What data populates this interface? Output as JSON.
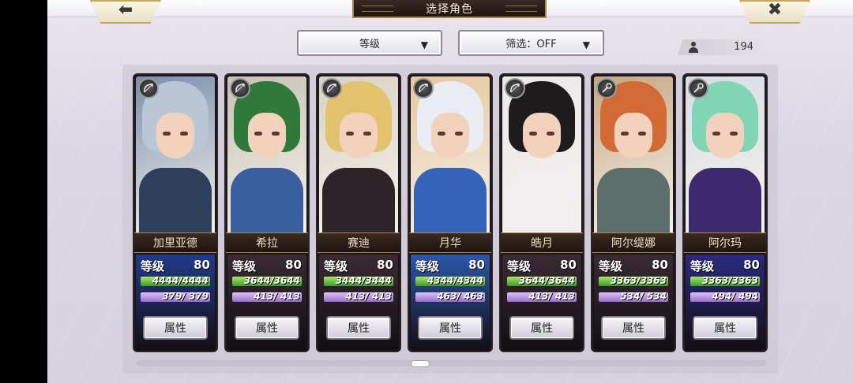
{
  "title": "选择角色",
  "nav": {
    "back_glyph": "⬅",
    "close_glyph": "✖"
  },
  "sort": {
    "label": "等级",
    "caret": "▼"
  },
  "filter": {
    "label": "筛选：OFF",
    "caret": "▼"
  },
  "count": {
    "value": "194"
  },
  "level_label": "等级",
  "attr_button_label": "属性",
  "characters": [
    {
      "name": "加里亚德",
      "level": "80",
      "hp": "4444/4444",
      "sp": "379/ 379",
      "class_icon": "bow-icon",
      "colors": {
        "bg": "#7a8fae",
        "hair": "#b9c6d6",
        "body": "#2e3f5c",
        "stats_bg": "#223a8a"
      }
    },
    {
      "name": "希拉",
      "level": "80",
      "hp": "3644/3644",
      "sp": "413/ 413",
      "class_icon": "bow-icon",
      "colors": {
        "bg": "#c8c2b6",
        "hair": "#2f7a3a",
        "body": "#3a5f9e",
        "stats_bg": "#3a2a33"
      }
    },
    {
      "name": "赛迪",
      "level": "80",
      "hp": "3444/3444",
      "sp": "413/ 413",
      "class_icon": "bow-icon",
      "colors": {
        "bg": "#d8d2c6",
        "hair": "#e3c26e",
        "body": "#2b2428",
        "stats_bg": "#3a2a33"
      }
    },
    {
      "name": "月华",
      "level": "80",
      "hp": "4344/4344",
      "sp": "463/ 463",
      "class_icon": "bow-icon",
      "colors": {
        "bg": "#e6c7a0",
        "hair": "#e9ecf2",
        "body": "#3563b8",
        "stats_bg": "#2b57a8"
      }
    },
    {
      "name": "皓月",
      "level": "80",
      "hp": "3644/3644",
      "sp": "413/ 413",
      "class_icon": "bow-icon",
      "colors": {
        "bg": "#ede8ec",
        "hair": "#1f1a1c",
        "body": "#f2eef0",
        "stats_bg": "#3a2a33"
      }
    },
    {
      "name": "阿尔缇娜",
      "level": "80",
      "hp": "3363/3363",
      "sp": "534/ 534",
      "class_icon": "staff-icon",
      "colors": {
        "bg": "#c7a785",
        "hair": "#d26a36",
        "body": "#5c6f6a",
        "stats_bg": "#3a2a33"
      }
    },
    {
      "name": "阿尔玛",
      "level": "80",
      "hp": "3363/3363",
      "sp": "494/ 494",
      "class_icon": "staff-icon",
      "colors": {
        "bg": "#d9dde6",
        "hair": "#7fd5b4",
        "body": "#3b2a6e",
        "stats_bg": "#2c2a80"
      }
    }
  ]
}
